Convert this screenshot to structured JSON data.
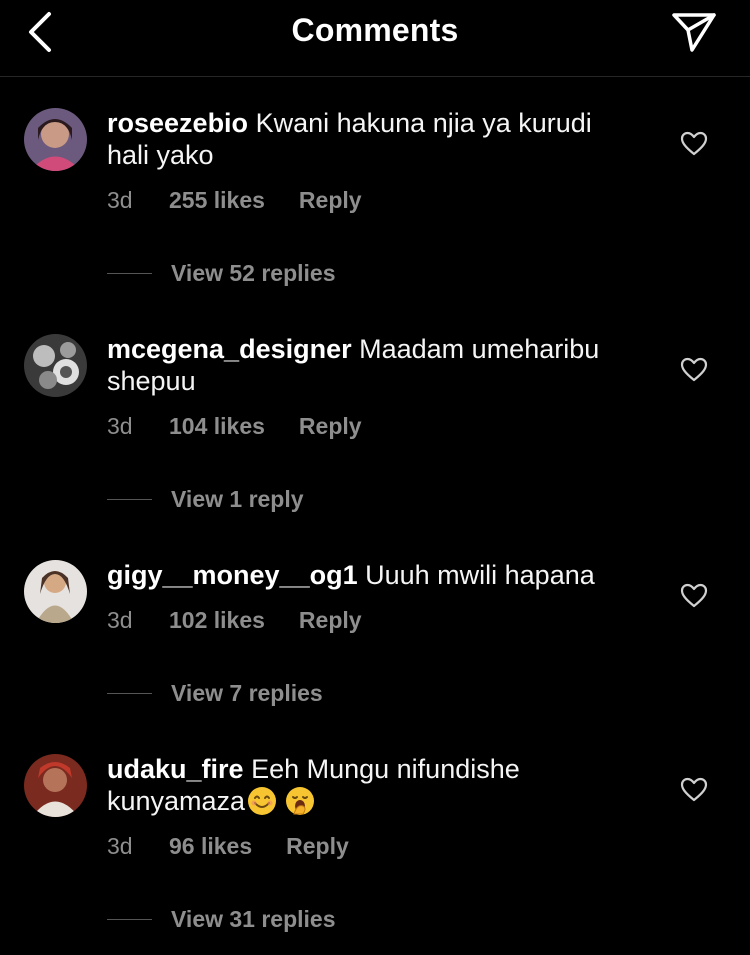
{
  "header": {
    "title": "Comments",
    "back_icon": "chevron-left-icon",
    "send_icon": "paper-plane-icon"
  },
  "colors": {
    "background": "#000000",
    "text": "#ffffff",
    "muted": "#8e8e8e",
    "divider": "#262626"
  },
  "comments": [
    {
      "username": "roseezebio",
      "text": "Kwani hakuna njia ya kurudi hali yako",
      "time": "3d",
      "likes": "255 likes",
      "reply": "Reply",
      "view_replies": "View 52 replies"
    },
    {
      "username": "mcegena_designer",
      "text": "Maadam umeharibu shepuu",
      "time": "3d",
      "likes": "104 likes",
      "reply": "Reply",
      "view_replies": "View 1 reply"
    },
    {
      "username": "gigy__money__og1",
      "text": "Uuuh mwili hapana",
      "time": "3d",
      "likes": "102 likes",
      "reply": "Reply",
      "view_replies": "View 7 replies"
    },
    {
      "username": "udaku_fire",
      "text": "Eeh Mungu nifundishe kunyamaza",
      "emojis": [
        "smiling-face-emoji",
        "yawning-face-emoji"
      ],
      "time": "3d",
      "likes": "96 likes",
      "reply": "Reply",
      "view_replies": "View 31 replies"
    }
  ]
}
